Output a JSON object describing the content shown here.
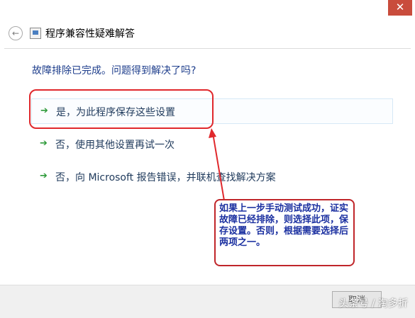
{
  "window": {
    "close_glyph": "✕"
  },
  "nav": {
    "back_icon": "back-arrow-icon",
    "back_glyph": "←",
    "title": "程序兼容性疑难解答"
  },
  "main": {
    "question": "故障排除已完成。问题得到解决了吗?",
    "options": [
      {
        "label": "是，为此程序保存这些设置",
        "icon": "green-arrow-icon",
        "highlighted": true
      },
      {
        "label": "否，使用其他设置再试一次",
        "icon": "green-arrow-icon",
        "highlighted": false
      },
      {
        "label": "否，向 Microsoft 报告错误，并联机查找解决方案",
        "icon": "green-arrow-icon",
        "highlighted": false
      }
    ],
    "arrow_glyph": "➔"
  },
  "annotation": {
    "text": "如果上一步手动测试成功，证实故障已经排除，则选择此项，保存设置。否则，根据需要选择后两项之一。",
    "box_color": "#e0282c",
    "text_color": "#1a2fa0"
  },
  "footer": {
    "button_label": "取消"
  },
  "watermark": {
    "text": "头条号 / 淘多折"
  }
}
